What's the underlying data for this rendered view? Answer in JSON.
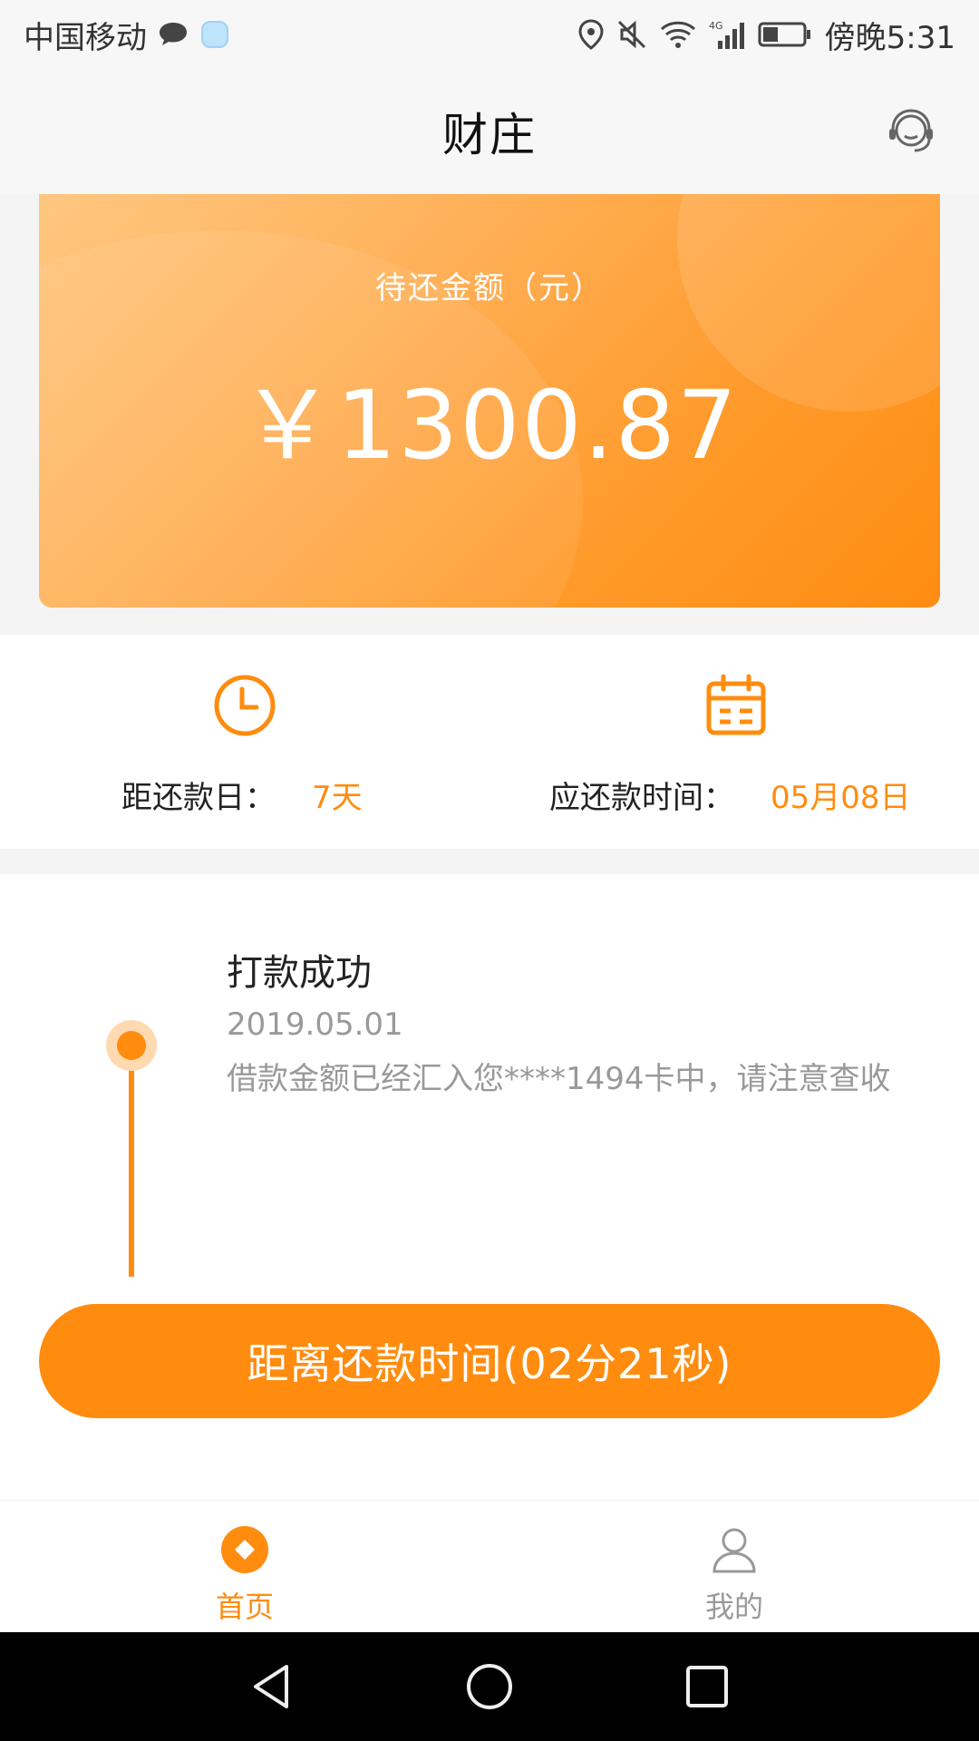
{
  "status_bar": {
    "carrier": "中国移动",
    "time": "傍晚5:31",
    "icons": [
      "chat-bubble-icon",
      "shield-icon",
      "location-icon",
      "mute-icon",
      "wifi-icon",
      "signal-4g-icon",
      "battery-icon"
    ]
  },
  "header": {
    "title": "财庄",
    "right_icon": "customer-service-icon"
  },
  "balance_card": {
    "label": "待还金额（元）",
    "amount": "￥1300.87"
  },
  "info": {
    "days_label": "距还款日：",
    "days_value": "7天",
    "due_label": "应还款时间：",
    "due_value": "05月08日"
  },
  "timeline": {
    "items": [
      {
        "title": "打款成功",
        "date": "2019.05.01",
        "description": "借款金额已经汇入您****1494卡中，请注意查收"
      }
    ]
  },
  "countdown_button": {
    "label": "距离还款时间(02分21秒)"
  },
  "tabs": [
    {
      "label": "首页",
      "icon": "home-icon",
      "active": true
    },
    {
      "label": "我的",
      "icon": "profile-icon",
      "active": false
    }
  ],
  "colors": {
    "accent": "#ff8c0f",
    "text_primary": "#222222",
    "text_secondary": "#999999"
  }
}
